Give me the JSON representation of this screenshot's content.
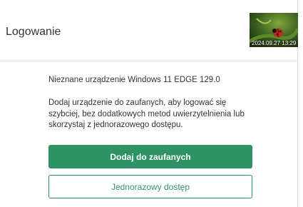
{
  "header": {
    "title": "Logowanie",
    "thumbnail": {
      "timestamp": "2024.09.27 13:29",
      "colors": {
        "background": "#2c4a16",
        "ladybug": "#c8281e"
      }
    }
  },
  "main": {
    "device_text": "Nieznane urządzenie Windows 11 EDGE 129.0",
    "description": "Dodaj urządzenie do zaufanych, aby logować się szybciej, bez dodatkowych metod uwierzytelnienia lub skorzystaj z jednorazowego dostępu.",
    "primary_button_label": "Dodaj do zaufanych",
    "secondary_button_label": "Jednorazowy dostęp"
  },
  "colors": {
    "accent": "#2f9266",
    "text": "#333333",
    "border": "#dcdcdc"
  }
}
